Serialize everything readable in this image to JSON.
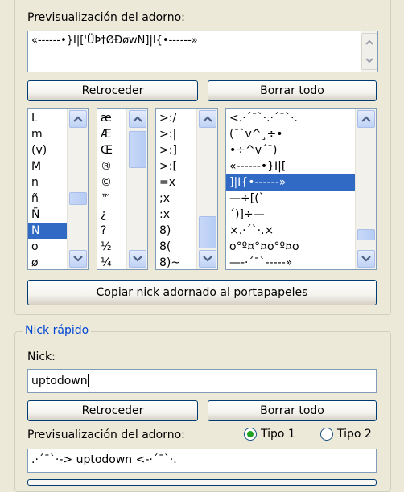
{
  "top": {
    "preview_label": "Previsualización del adorno:",
    "preview_text": "«------•}I|['ÜÞ†ØÐøwN]|I{•------»",
    "back_label": "Retroceder",
    "clear_label": "Borrar todo",
    "copy_label": "Copiar nick adornado al portapapeles"
  },
  "lists": {
    "letters": [
      "L",
      "m",
      "(v)",
      "M",
      "n",
      "ñ",
      "Ñ",
      "N",
      "o",
      "ø"
    ],
    "letters_selected": "N",
    "symbols": [
      "æ",
      "Æ",
      "Œ",
      "®",
      "©",
      "™",
      "¿",
      "?",
      "½",
      "¼"
    ],
    "emoticons": [
      ">:/",
      ">:|",
      ">:]",
      ">:[",
      "=x",
      ";x",
      ":x",
      "8)",
      "8(",
      "8)~"
    ],
    "decorations": [
      "<.·´¯`·.·´¯`·.",
      "(¯`v^¸÷•",
      "•÷^v´¯)",
      "«------•}I|[",
      "]|I{•------»",
      "—÷[(`",
      "´)]÷—",
      "×.·´`·.×",
      "o°º¤°¤o°º¤o",
      "—-·´¯`-----»"
    ],
    "decorations_selected": "]|I{•------»"
  },
  "quick": {
    "title": "Nick rápido",
    "nick_label": "Nick:",
    "nick_value": "uptodown",
    "back_label": "Retroceder",
    "clear_label": "Borrar todo",
    "preview_label": "Previsualización del adorno:",
    "tipo1_label": "Tipo 1",
    "tipo2_label": "Tipo 2",
    "tipo_selected": "Tipo 1",
    "preview_text": ".·´¯`·-> uptodown <-·´¯`·."
  }
}
